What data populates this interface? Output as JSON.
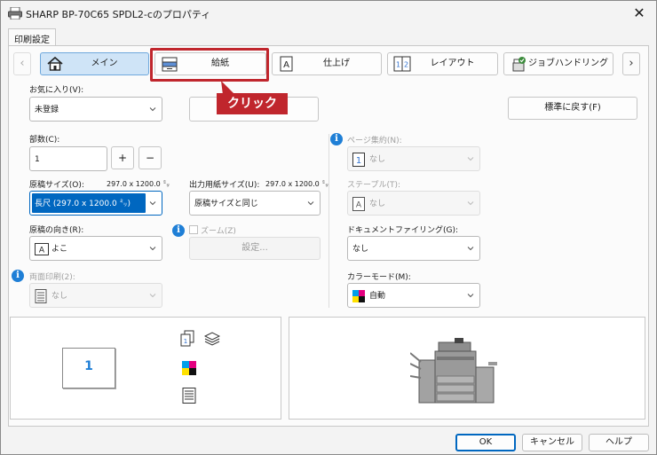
{
  "window": {
    "title": "SHARP BP-70C65 SPDL2-cのプロパティ",
    "close_glyph": "✕"
  },
  "tabs": [
    {
      "label": "印刷設定"
    }
  ],
  "nav": {
    "prev_glyph": "‹",
    "next_glyph": "›",
    "items": [
      {
        "label": "メイン",
        "icon": "home-icon",
        "selected": true
      },
      {
        "label": "給紙",
        "icon": "paper-tray-icon",
        "selected": false
      },
      {
        "label": "仕上げ",
        "icon": "finishing-icon",
        "selected": false
      },
      {
        "label": "レイアウト",
        "icon": "layout-icon",
        "selected": false
      },
      {
        "label": "ジョブハンドリング",
        "icon": "job-handling-icon",
        "selected": false
      }
    ]
  },
  "favorites": {
    "label": "お気に入り(V):",
    "value": "未登録",
    "reset_label": "標準に戻す(F)"
  },
  "copies": {
    "label": "部数(C):",
    "value": "1",
    "plus": "+",
    "minus": "−"
  },
  "original_size": {
    "label": "原稿サイズ(O):",
    "dims": "297.0 x 1200.0 ㍉",
    "value": "長尺 (297.0 x 1200.0 ㍉)"
  },
  "output_size": {
    "label": "出力用紙サイズ(U):",
    "dims": "297.0 x 1200.0 ㍉",
    "value": "原稿サイズと同じ"
  },
  "orientation": {
    "label": "原稿の向き(R):",
    "value": "よこ",
    "icon_letter": "A"
  },
  "zoom": {
    "label": "ズーム(Z)",
    "settings_label": "設定..."
  },
  "duplex": {
    "label": "両面印刷(2):",
    "value": "なし"
  },
  "nup": {
    "label": "ページ集約(N):",
    "value": "なし",
    "icon_digit": "1"
  },
  "staple": {
    "label": "ステープル(T):",
    "value": "なし",
    "icon_letter": "A"
  },
  "document_filing": {
    "label": "ドキュメントファイリング(G):",
    "value": "なし"
  },
  "color_mode": {
    "label": "カラーモード(M):",
    "value": "自動"
  },
  "preview": {
    "page_number": "1"
  },
  "footer": {
    "ok": "OK",
    "cancel": "キャンセル",
    "help": "ヘルプ"
  },
  "annotation": {
    "label": "クリック",
    "color": "#c0262d"
  },
  "colors": {
    "accent": "#0067c0",
    "selected_bg": "#cfe4f7",
    "info": "#1f7fd6"
  }
}
